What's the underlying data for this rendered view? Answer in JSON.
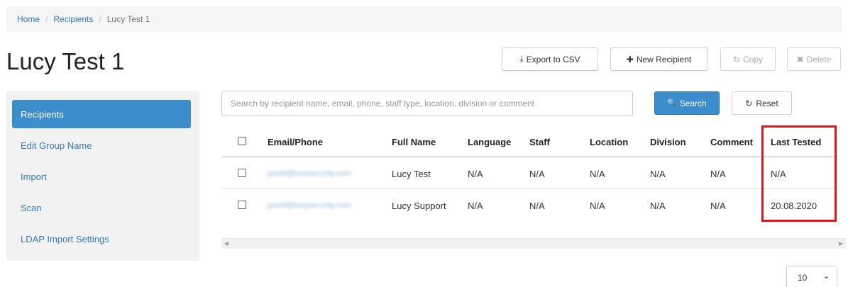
{
  "breadcrumb": {
    "home": "Home",
    "recipients": "Recipients",
    "current": "Lucy Test 1",
    "separator": "/"
  },
  "page": {
    "title": "Lucy Test 1"
  },
  "toolbar": {
    "export": "Export to CSV",
    "new_recipient": "New Recipient",
    "copy": "Copy",
    "delete": "Delete",
    "export_icon": "⤓",
    "new_icon": "✚",
    "copy_icon": "↻",
    "delete_icon": "✖"
  },
  "sidebar": {
    "items": [
      {
        "label": "Recipients"
      },
      {
        "label": "Edit Group Name"
      },
      {
        "label": "Import"
      },
      {
        "label": "Scan"
      },
      {
        "label": "LDAP Import Settings"
      }
    ]
  },
  "search": {
    "placeholder": "Search by recipient name, email, phone, staff type, location, division or comment",
    "button": "Search",
    "reset": "Reset",
    "search_icon": "🔍",
    "reset_icon": "↻"
  },
  "table": {
    "columns": [
      "Email/Phone",
      "Full Name",
      "Language",
      "Staff",
      "Location",
      "Division",
      "Comment",
      "Last Tested"
    ],
    "rows": [
      {
        "email": "pavel@lucysecurity.com",
        "name": "Lucy Test",
        "language": "N/A",
        "staff": "N/A",
        "location": "N/A",
        "division": "N/A",
        "comment": "N/A",
        "last_tested": "N/A"
      },
      {
        "email": "pavel@lucysecurity.com",
        "name": "Lucy Support",
        "language": "N/A",
        "staff": "N/A",
        "location": "N/A",
        "division": "N/A",
        "comment": "N/A",
        "last_tested": "20.08.2020"
      }
    ]
  },
  "pagination": {
    "page_size": "10",
    "chevron": "⌄"
  },
  "colors": {
    "accent": "#3c8dcb",
    "link": "#337ab7",
    "highlight": "#e3161c"
  }
}
